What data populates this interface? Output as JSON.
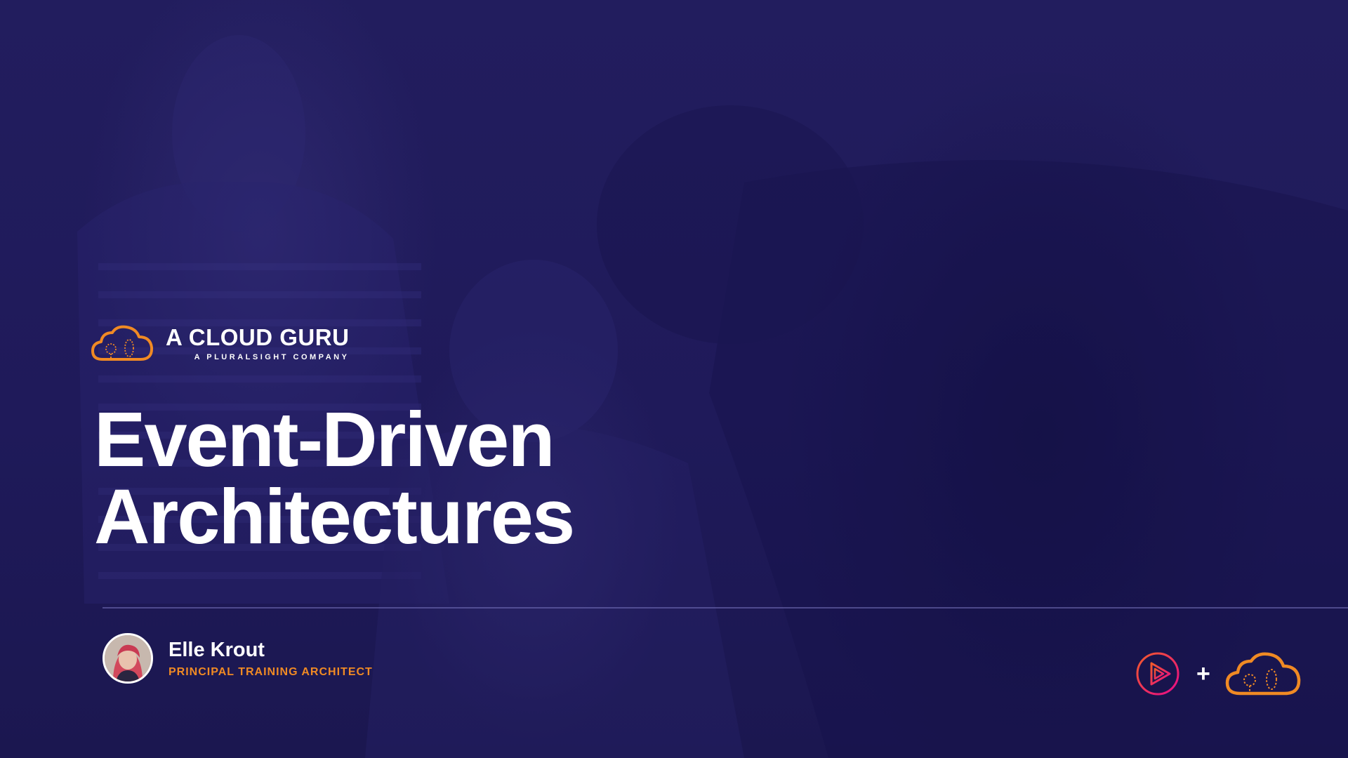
{
  "brand": {
    "name": "A CLOUD GURU",
    "subtitle": "A PLURALSIGHT COMPANY"
  },
  "title": {
    "line1": "Event-Driven",
    "line2": "Architectures"
  },
  "presenter": {
    "name": "Elle Krout",
    "role": "PRINCIPAL TRAINING ARCHITECT"
  },
  "partner": {
    "plus": "+"
  },
  "icons": {
    "brand_logo": "cloud-guru-logo-icon",
    "avatar": "presenter-avatar",
    "pluralsight_logo": "pluralsight-play-icon",
    "partner_cloud_logo": "cloud-guru-cloud-icon"
  },
  "colors": {
    "background": "#1f1a5a",
    "accent_orange": "#f08a24",
    "pluralsight_pink": "#e5306f",
    "text_white": "#ffffff"
  }
}
